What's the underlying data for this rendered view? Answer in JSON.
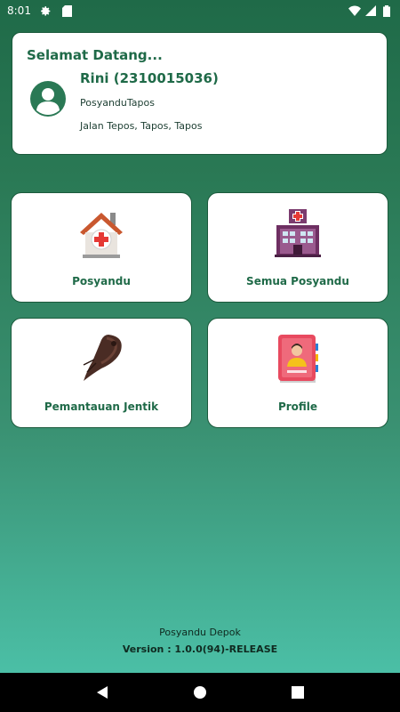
{
  "status_bar": {
    "time": "8:01",
    "icons": [
      "gear-icon",
      "sim-card-icon",
      "wifi-icon",
      "signal-icon",
      "battery-icon"
    ]
  },
  "welcome": {
    "title": "Selamat Datang...",
    "user_name": "Rini (2310015036)",
    "posyandu": "PosyanduTapos",
    "address": "Jalan Tepos, Tapos, Tapos",
    "avatar_icon": "user-avatar-icon"
  },
  "menu": {
    "items": [
      {
        "label": "Posyandu",
        "icon": "house-medical-icon"
      },
      {
        "label": "Semua Posyandu",
        "icon": "hospital-building-icon"
      },
      {
        "label": "Pemantauan Jentik",
        "icon": "mosquito-larva-icon"
      },
      {
        "label": "Profile",
        "icon": "profile-book-icon"
      }
    ]
  },
  "footer": {
    "app_name": "Posyandu Depok",
    "version": "Version : 1.0.0(94)-RELEASE"
  },
  "nav_bar": {
    "buttons": [
      "back-icon",
      "home-icon",
      "recents-icon"
    ]
  },
  "colors": {
    "primary": "#1f6a48",
    "gradient_top": "#1f6a48",
    "gradient_bottom": "#4bbfa6",
    "card_background": "#ffffff"
  }
}
